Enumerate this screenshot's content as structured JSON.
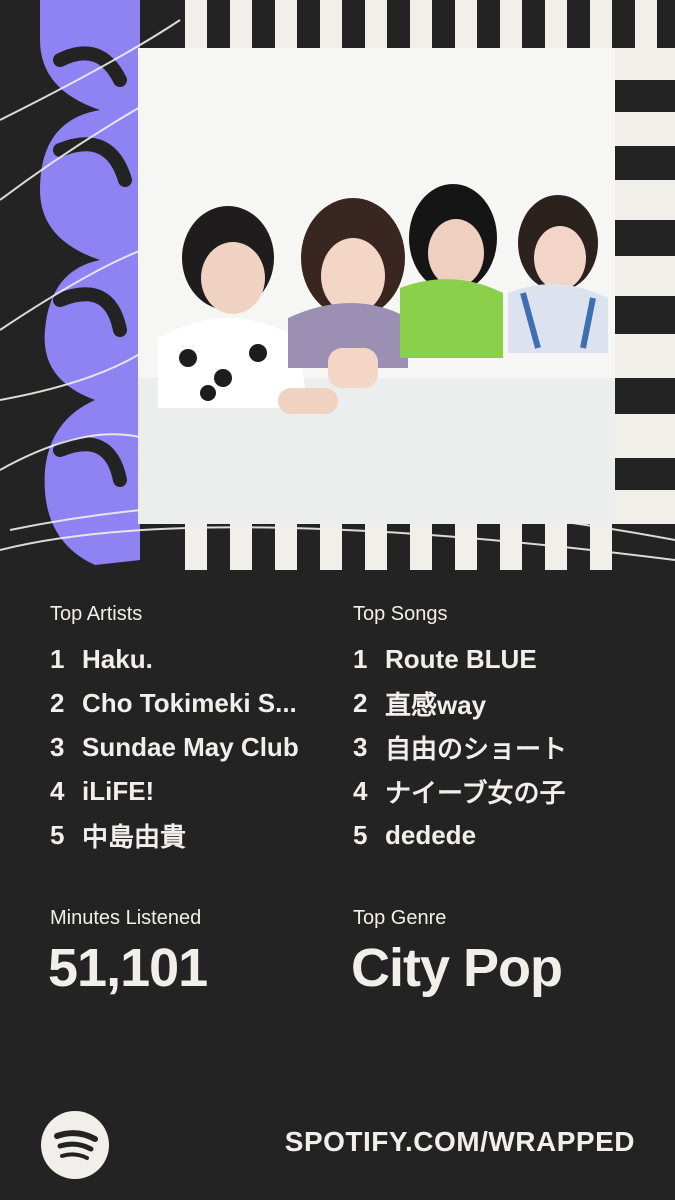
{
  "top_artists": {
    "label": "Top Artists",
    "items": [
      {
        "rank": "1",
        "name": "Haku."
      },
      {
        "rank": "2",
        "name": "Cho Tokimeki S..."
      },
      {
        "rank": "3",
        "name": "Sundae May Club"
      },
      {
        "rank": "4",
        "name": "iLiFE!"
      },
      {
        "rank": "5",
        "name": "中島由貴"
      }
    ]
  },
  "top_songs": {
    "label": "Top Songs",
    "items": [
      {
        "rank": "1",
        "name": "Route BLUE"
      },
      {
        "rank": "2",
        "name": "直感way"
      },
      {
        "rank": "3",
        "name": "自由のショート"
      },
      {
        "rank": "4",
        "name": "ナイーブ女の子"
      },
      {
        "rank": "5",
        "name": "dedede"
      }
    ]
  },
  "minutes": {
    "label": "Minutes Listened",
    "value": "51,101"
  },
  "genre": {
    "label": "Top Genre",
    "value": "City Pop"
  },
  "footer": {
    "url": "SPOTIFY.COM/WRAPPED"
  },
  "icons": {
    "logo": "spotify-logo-icon",
    "year_art": "year-2025-graphic",
    "photo": "artist-photo"
  },
  "colors": {
    "background": "#232323",
    "text": "#f1efe9",
    "accent_purple": "#8f83f4",
    "photo_bg": "#f6f6f4"
  }
}
